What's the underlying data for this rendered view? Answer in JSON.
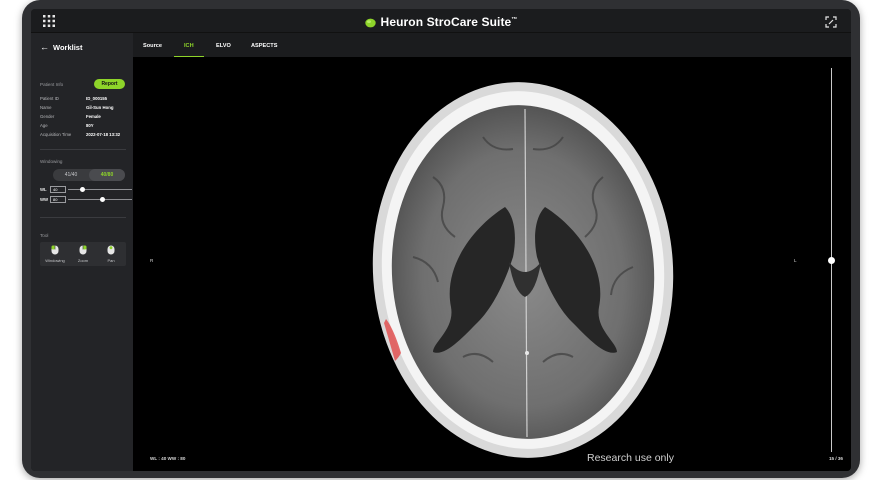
{
  "app": {
    "title": "Heuron StroCare Suite",
    "trademark": "™",
    "accent_color": "#8ed42a",
    "grid_icon": "app-grid-icon",
    "expand_icon": "expand-icon"
  },
  "sidebar": {
    "back_label": "Worklist",
    "back_icon": "arrow-left-icon",
    "patient_info_label": "Patient Info",
    "report_button": "Report",
    "patient": {
      "id_label": "Patient ID",
      "id_value": "ID_000155",
      "name_label": "Name",
      "name_value": "Gil-Sun Hong",
      "gender_label": "Gender",
      "gender_value": "Female",
      "age_label": "Age",
      "age_value": "80Y",
      "acq_label": "Acquisition Time",
      "acq_value": "2022-07-18 13:32"
    },
    "windowing": {
      "label": "Windowing",
      "options": [
        "41/40",
        "40/80"
      ],
      "selected": "40/80",
      "wl_label": "WL",
      "wl_value": "40",
      "wl_level": 0.23,
      "ww_label": "WW",
      "ww_value": "80",
      "ww_level": 0.54
    },
    "tool": {
      "label": "Tool",
      "items": [
        {
          "label": "Windowing",
          "icon": "mouse-icon"
        },
        {
          "label": "Zoom",
          "icon": "mouse-icon"
        },
        {
          "label": "Pan",
          "icon": "mouse-icon"
        }
      ]
    }
  },
  "tabs": {
    "items": [
      "Source",
      "ICH",
      "ELVO",
      "ASPECTS"
    ],
    "active": "ICH"
  },
  "viewer": {
    "left_marker": "R",
    "right_marker": "L",
    "wl_ww_text": "WL : 40  WW : 80",
    "watermark": "Research use only",
    "slice_text": "15 / 36",
    "slice_level": 0.5,
    "hemorrhage_color": "#e05050"
  }
}
